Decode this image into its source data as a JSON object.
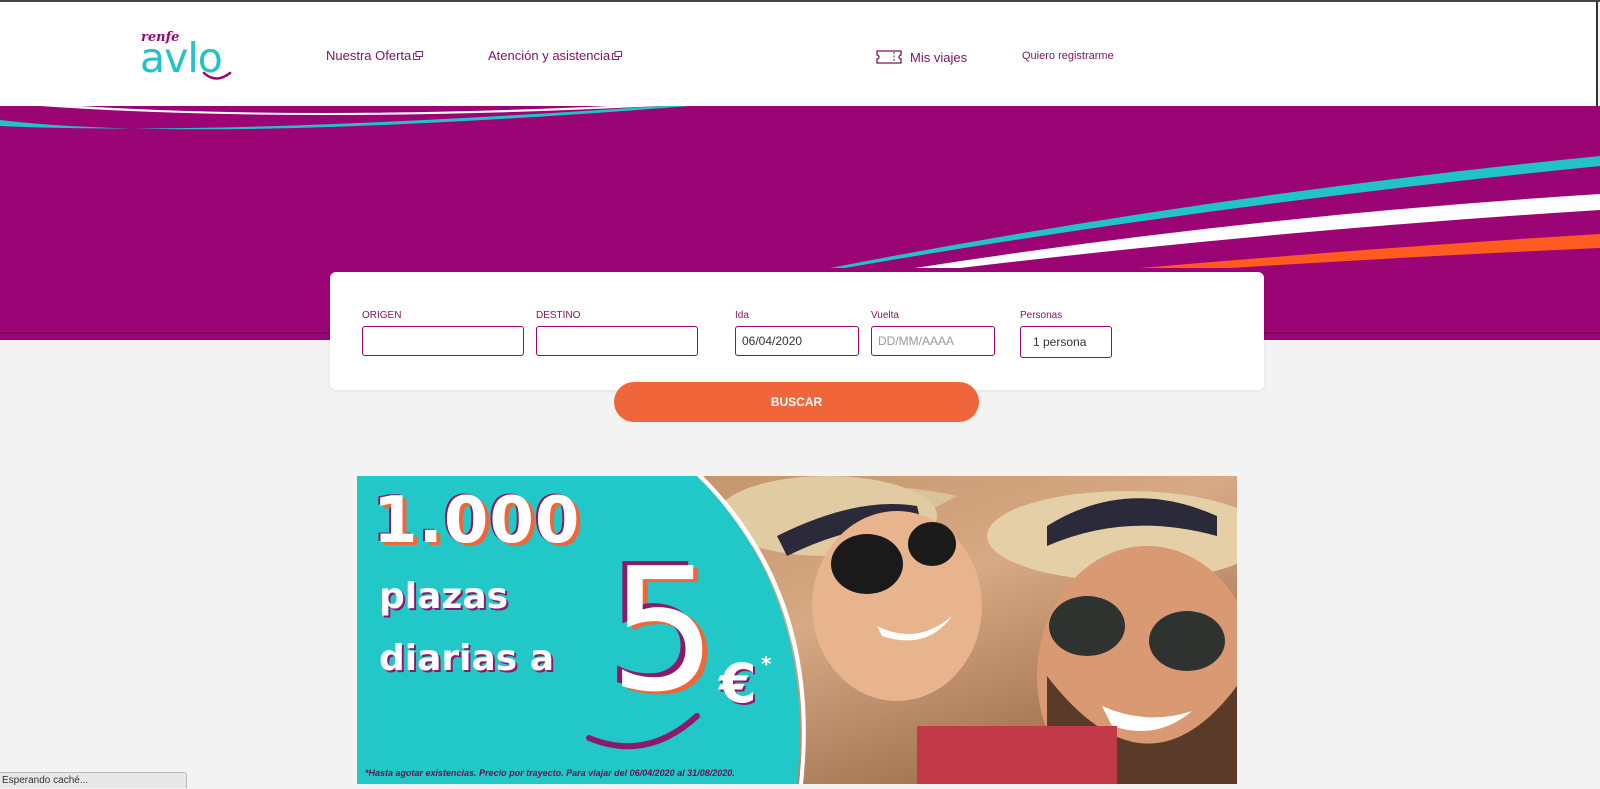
{
  "brand": {
    "small": "renfe",
    "main": "avlo"
  },
  "nav": {
    "oferta": "Nuestra Oferta",
    "atencion": "Atención y asistencia",
    "mis_viajes": "Mis viajes",
    "registrarme": "Quiero registrarme"
  },
  "search": {
    "origen_label": "ORIGEN",
    "destino_label": "DESTINO",
    "ida_label": "Ida",
    "ida_value": "06/04/2020",
    "vuelta_label": "Vuelta",
    "vuelta_placeholder": "DD/MM/AAAA",
    "personas_label": "Personas",
    "personas_value": "1 persona",
    "button": "BUSCAR"
  },
  "promo": {
    "headline": "1.000",
    "line1": "plazas",
    "line2": "diarias a",
    "price": "5",
    "currency": "€",
    "asterisk": "*",
    "legal": "*Hasta agotar existencias. Precio por trayecto. Para viajar del 06/04/2020 al 31/08/2020."
  },
  "status_bar": "Esperando caché...",
  "colors": {
    "brand_purple": "#9b0474",
    "teal": "#22c3c7",
    "orange": "#f1653a",
    "link": "#7a1461"
  }
}
